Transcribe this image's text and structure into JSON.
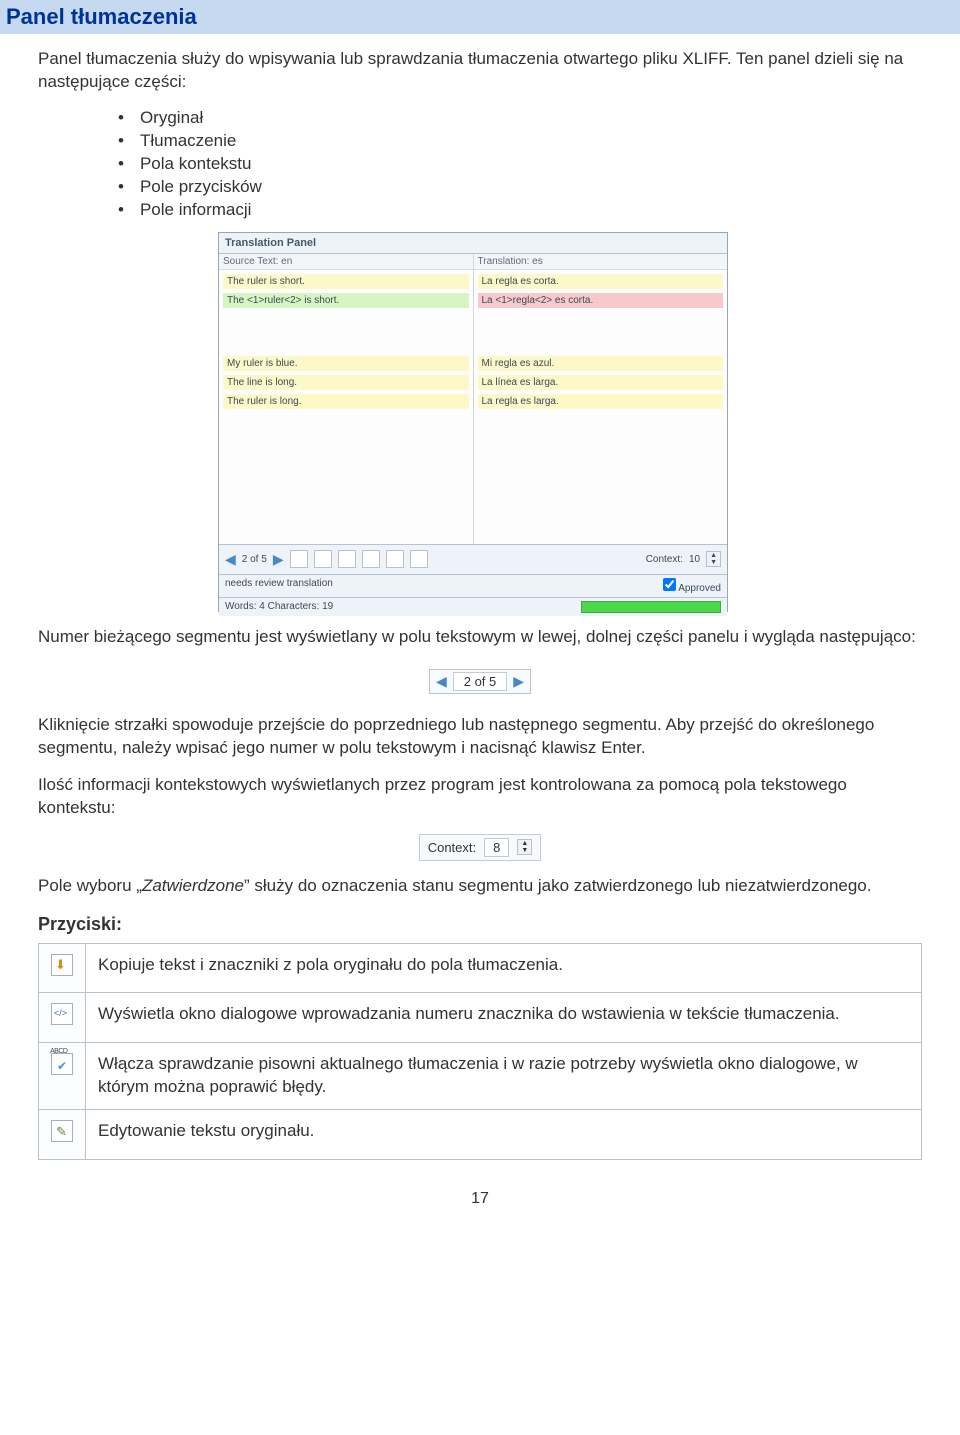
{
  "header": {
    "title": "Panel tłumaczenia"
  },
  "intro": "Panel tłumaczenia służy do wpisywania lub sprawdzania tłumaczenia otwartego pliku XLIFF. Ten panel dzieli się na następujące części:",
  "parts": [
    "Oryginał",
    "Tłumaczenie",
    "Pola kontekstu",
    "Pole przycisków",
    "Pole informacji"
  ],
  "screenshot": {
    "panel_title": "Translation Panel",
    "left_label": "Source Text: en",
    "right_label": "Translation: es",
    "rows_left": [
      {
        "t": "The ruler is short.",
        "cls": "seg-y"
      },
      {
        "t": "The <1>ruler<2> is short.",
        "cls": "seg-g"
      },
      {
        "t": "My ruler is blue.",
        "cls": "seg-y"
      },
      {
        "t": "The line is long.",
        "cls": "seg-y"
      },
      {
        "t": "The ruler is long.",
        "cls": "seg-y"
      }
    ],
    "rows_right": [
      {
        "t": "La regla es corta.",
        "cls": "seg-y"
      },
      {
        "t": "La <1>regla<2> es corta.",
        "cls": "seg-r"
      },
      {
        "t": "Mi regla es azul.",
        "cls": "seg-y"
      },
      {
        "t": "La línea es larga.",
        "cls": "seg-y"
      },
      {
        "t": "La regla es larga.",
        "cls": "seg-y"
      }
    ],
    "nav": "2 of 5",
    "context_label": "Context:",
    "context_value": "10",
    "status_left_prefix": "needs review translation",
    "approved_label": "Approved",
    "words_label": "Words: 4 Characters: 19"
  },
  "para1": "Numer bieżącego segmentu jest wyświetlany w polu tekstowym w lewej, dolnej części panelu i wygląda następująco:",
  "nav_widget": "2 of 5",
  "para2": "Kliknięcie strzałki spowoduje przejście do poprzedniego lub następnego segmentu. Aby przejść do określonego segmentu, należy wpisać jego numer w polu tekstowym i nacisnąć klawisz Enter.",
  "para3": "Ilość informacji kontekstowych wyświetlanych przez program jest kontrolowana za pomocą pola tekstowego kontekstu:",
  "context_widget": {
    "label": "Context:",
    "value": "8"
  },
  "para4_a": "Pole wyboru „",
  "para4_em": "Zatwierdzone",
  "para4_b": "” służy do oznaczenia stanu segmentu jako zatwierdzonego lub niezatwierdzonego.",
  "buttons_head": "Przyciski:",
  "buttons": [
    {
      "icon": "mi-arrow",
      "desc": "Kopiuje tekst i znaczniki z pola oryginału do pola tłumaczenia."
    },
    {
      "icon": "mi-tag",
      "desc": "Wyświetla okno dialogowe wprowadzania numeru znacznika do wstawienia w tekście tłumaczenia."
    },
    {
      "icon": "mi-abcd",
      "desc": "Włącza sprawdzanie pisowni aktualnego tłumaczenia i w razie potrzeby wyświetla okno dialogowe, w którym można poprawić błędy."
    },
    {
      "icon": "mi-edit",
      "desc": "Edytowanie tekstu oryginału."
    }
  ],
  "page_number": "17"
}
